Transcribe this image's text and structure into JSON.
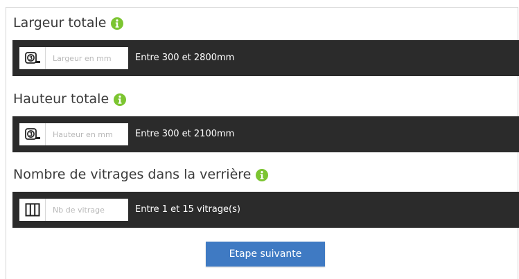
{
  "colors": {
    "bar_background": "#2b2b2b",
    "info_icon": "#7cc531",
    "button_background": "#3f7ac3",
    "title_text": "#3a3a3a"
  },
  "width_section": {
    "title": "Largeur totale",
    "info_icon": "info-icon",
    "input_icon": "tape-measure-icon",
    "input_placeholder": "Largeur en mm",
    "input_value": "",
    "hint": "Entre 300 et 2800mm"
  },
  "height_section": {
    "title": "Hauteur totale",
    "info_icon": "info-icon",
    "input_icon": "tape-measure-icon",
    "input_placeholder": "Hauteur en mm",
    "input_value": "",
    "hint": "Entre 300 et 2100mm"
  },
  "glazing_section": {
    "title": "Nombre de vitrages dans la verrière",
    "info_icon": "info-icon",
    "input_icon": "window-panes-icon",
    "input_placeholder": "Nb de vitrage",
    "input_value": "",
    "hint": "Entre 1 et 15 vitrage(s)"
  },
  "actions": {
    "next_label": "Etape suivante"
  }
}
